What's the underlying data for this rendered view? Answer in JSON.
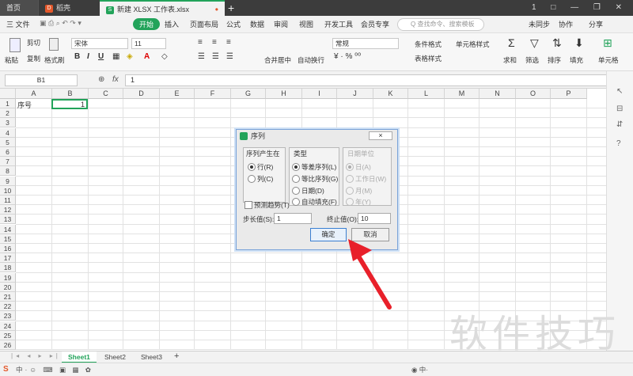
{
  "tabs": {
    "home": "首页",
    "doc": "稻壳",
    "xlsx": "新建 XLSX 工作表.xlsx",
    "plus": "+"
  },
  "window": {
    "controls": "1  □  —  ❐  ✕"
  },
  "menubar": {
    "file": "三 文件",
    "items": [
      "开始",
      "插入",
      "页面布局",
      "公式",
      "数据",
      "审阅",
      "视图",
      "开发工具",
      "会员专享"
    ],
    "search_placeholder": "Q 查找命令、搜索模板",
    "sync": "未同步",
    "collab": "协作",
    "share": "分享"
  },
  "ribbon": {
    "paste": "粘贴",
    "cut": "剪切",
    "copy": "复制",
    "format_painter": "格式刷",
    "font": "宋体",
    "size": "11",
    "merge": "合并居中",
    "wrap": "自动换行",
    "number_format": "常规",
    "cond": "条件格式",
    "table_style": "表格样式",
    "cell_style": "单元格样式",
    "sum": "求和",
    "filter": "筛选",
    "sort": "排序",
    "fill": "填充",
    "cell": "单元格"
  },
  "formula": {
    "cell_ref": "B1",
    "fx": "fx",
    "value": "1"
  },
  "grid": {
    "columns": [
      "A",
      "B",
      "C",
      "D",
      "E",
      "F",
      "G",
      "H",
      "I",
      "J",
      "K",
      "L",
      "M",
      "N",
      "O",
      "P"
    ],
    "rows": [
      "1",
      "2",
      "3",
      "4",
      "5",
      "6",
      "7",
      "8",
      "9",
      "10",
      "11",
      "12",
      "13",
      "14",
      "15",
      "16",
      "17",
      "18",
      "19",
      "20",
      "21",
      "22",
      "23",
      "24",
      "25",
      "26"
    ],
    "a1": "序号",
    "b1": "1"
  },
  "sheets": [
    "Sheet1",
    "Sheet2",
    "Sheet3"
  ],
  "dialog": {
    "title": "序列",
    "group_origin": "序列产生在",
    "origin_row": "行(R)",
    "origin_col": "列(C)",
    "group_type": "类型",
    "type_linear": "等差序列(L)",
    "type_growth": "等比序列(G)",
    "type_date": "日期(D)",
    "type_autofill": "自动填充(F)",
    "group_date": "日期单位",
    "date_day": "日(A)",
    "date_workday": "工作日(W)",
    "date_month": "月(M)",
    "date_year": "年(Y)",
    "trend": "预测趋势(T)",
    "step_label": "步长值(S):",
    "step_value": "1",
    "stop_label": "终止值(O):",
    "stop_value": "10",
    "ok": "确定",
    "cancel": "取消",
    "close": "×"
  },
  "watermark": "软件技巧",
  "colors": {
    "accent": "#22a35a",
    "arrow": "#e8202a",
    "selection": "#22a35a"
  }
}
